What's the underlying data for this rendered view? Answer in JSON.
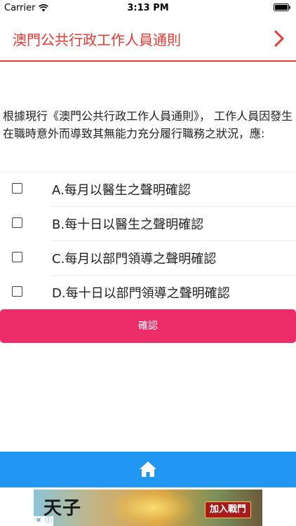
{
  "status_bar": {
    "carrier": "Carrier",
    "time": "3:13 PM"
  },
  "nav": {
    "title": "澳門公共行政工作人員通則",
    "next_icon": "chevron-right-icon"
  },
  "question": {
    "text": "根據現行《澳門公共行政工作人員通則》， 工作人員因發生在職時意外而導致其無能力充分履行職務之狀況，應:"
  },
  "options": [
    {
      "label": "A.每月以醫生之聲明確認",
      "checked": false
    },
    {
      "label": "B.每十日以醫生之聲明確認",
      "checked": false
    },
    {
      "label": "C.每月以部門領導之聲明確認",
      "checked": false
    },
    {
      "label": "D.每十日以部門領導之聲明確認",
      "checked": false
    }
  ],
  "confirm_label": "確認",
  "tab_bar": {
    "home_icon": "home-icon"
  },
  "ad": {
    "title": "天子",
    "cta": "加入戰鬥",
    "badge_close": "✕",
    "badge_info": "ⓘ"
  },
  "colors": {
    "accent": "#e53935",
    "confirm": "#ec2d6a",
    "tab_bar": "#2196f3"
  }
}
